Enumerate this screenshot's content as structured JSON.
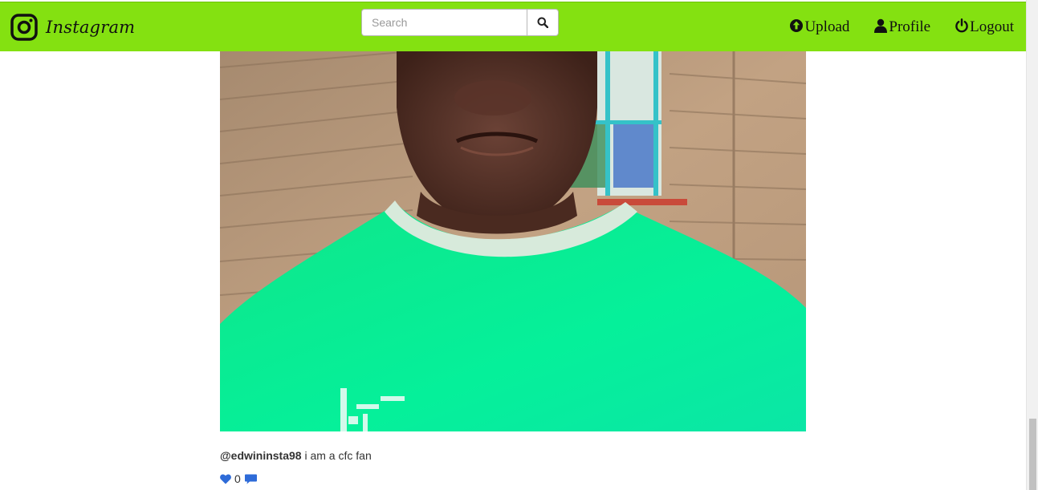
{
  "navbar": {
    "brand_name": "Instagram",
    "search": {
      "placeholder": "Search",
      "value": ""
    },
    "links": {
      "upload": "Upload",
      "profile": "Profile",
      "logout": "Logout"
    },
    "background_color": "#84e111"
  },
  "post": {
    "username": "@edwininsta98",
    "caption": "i am a cfc fan",
    "likes": "0",
    "shirt_color": "#08e98a",
    "icon_color": "#2e6bd8"
  }
}
